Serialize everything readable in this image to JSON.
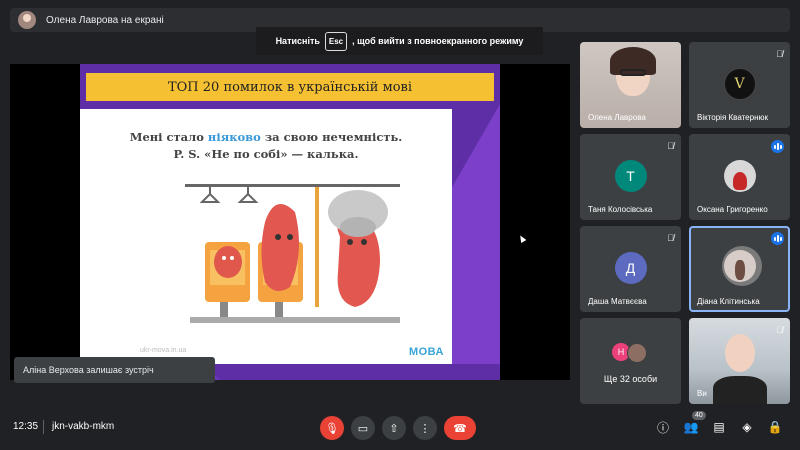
{
  "topbar": {
    "presenter_label": "Олена Лаврова на екрані"
  },
  "fullscreen_hint": {
    "prefix": "Натисніть",
    "key": "Esc",
    "suffix": ", щоб вийти з повноекранного режиму"
  },
  "slide": {
    "title": "ТОП 20 помилок в українській мові",
    "line1_a": "Мені стало ",
    "line1_highlight": "ніяково",
    "line1_b": " за свою нечемність.",
    "line2": "P. S. «Не по собі» — калька.",
    "url": "ukr-mova.in.ua",
    "logo": "МОВА"
  },
  "toast": {
    "text": "Аліна Верхова залишає зустріч"
  },
  "tiles": [
    {
      "name": "Олена Лаврова",
      "muted": false
    },
    {
      "name": "Вікторія Кватернюк",
      "muted": true,
      "avatar_letter": "V"
    },
    {
      "name": "Таня Колосівська",
      "muted": true,
      "avatar_letter": "Т",
      "avatar_color": "#00897b"
    },
    {
      "name": "Оксана Григоренко",
      "speaking": true
    },
    {
      "name": "Даша Матвєєва",
      "muted": true,
      "avatar_letter": "Д",
      "avatar_color": "#5c6bc0"
    },
    {
      "name": "Діана Клітинська",
      "speaking": true
    },
    {
      "more_label": "Ще 32 особи",
      "avatar_letter": "Н"
    },
    {
      "name": "Ви",
      "muted": true
    }
  ],
  "bottombar": {
    "clock": "12:35",
    "meeting_code": "jkn-vakb-mkm",
    "people_count": "40"
  },
  "colors": {
    "end_call": "#ea4335",
    "accent_blue": "#1a73e8",
    "slide_yellow": "#f6c033",
    "slide_purple": "#5d2ea5"
  }
}
